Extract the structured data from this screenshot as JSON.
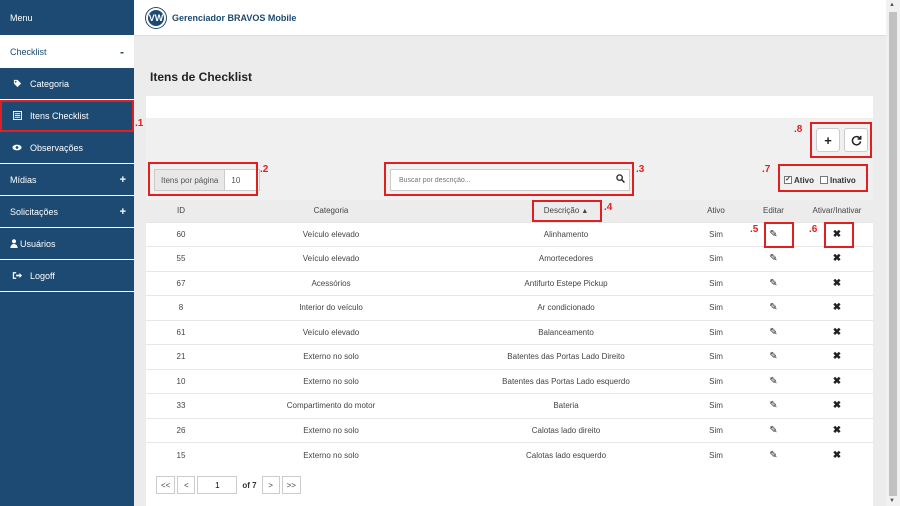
{
  "app": {
    "title": "Gerenciador BRAVOS Mobile",
    "logo": "VW"
  },
  "sidebar": {
    "menu_label": "Menu",
    "items": [
      {
        "label": "Checklist",
        "toggle": "-"
      },
      {
        "label": "Categoria",
        "icon": "tag-icon"
      },
      {
        "label": "Itens Checklist",
        "icon": "list-icon"
      },
      {
        "label": "Observações",
        "icon": "eye-icon"
      },
      {
        "label": "Mídias",
        "toggle": "+"
      },
      {
        "label": "Solicitações",
        "toggle": "+"
      },
      {
        "label": "Usuários",
        "icon": "user-icon"
      },
      {
        "label": "Logoff",
        "icon": "logout-icon"
      }
    ]
  },
  "page": {
    "title": "Itens de Checklist"
  },
  "controls": {
    "items_per_page_label": "Itens por página",
    "items_per_page_value": "10",
    "search_placeholder": "Buscar por descrição...",
    "filter_active": "Ativo",
    "filter_inactive": "Inativo",
    "add_symbol": "+",
    "refresh_symbol": "↻"
  },
  "annotations": [
    ".1",
    ".2",
    ".3",
    ".4",
    ".5",
    ".6",
    ".7",
    ".8"
  ],
  "table": {
    "headers": [
      "ID",
      "Categoria",
      "Descrição",
      "Ativo",
      "Editar",
      "Ativar/Inativar"
    ],
    "sort_indicator": "▲",
    "rows": [
      {
        "id": "60",
        "cat": "Veículo elevado",
        "desc": "Alinhamento",
        "ativo": "Sim"
      },
      {
        "id": "55",
        "cat": "Veículo elevado",
        "desc": "Amortecedores",
        "ativo": "Sim"
      },
      {
        "id": "67",
        "cat": "Acessórios",
        "desc": "Antifurto Estepe Pickup",
        "ativo": "Sim"
      },
      {
        "id": "8",
        "cat": "Interior do veículo",
        "desc": "Ar condicionado",
        "ativo": "Sim"
      },
      {
        "id": "61",
        "cat": "Veículo elevado",
        "desc": "Balanceamento",
        "ativo": "Sim"
      },
      {
        "id": "21",
        "cat": "Externo no solo",
        "desc": "Batentes das Portas Lado Direito",
        "ativo": "Sim"
      },
      {
        "id": "10",
        "cat": "Externo no solo",
        "desc": "Batentes das Portas Lado esquerdo",
        "ativo": "Sim"
      },
      {
        "id": "33",
        "cat": "Compartimento do motor",
        "desc": "Bateria",
        "ativo": "Sim"
      },
      {
        "id": "26",
        "cat": "Externo no solo",
        "desc": "Calotas lado direito",
        "ativo": "Sim"
      },
      {
        "id": "15",
        "cat": "Externo no solo",
        "desc": "Calotas lado esquerdo",
        "ativo": "Sim"
      }
    ]
  },
  "pagination": {
    "first": "<<",
    "prev": "<",
    "current": "1",
    "of_label": "of 7",
    "next": ">",
    "last": ">>"
  }
}
